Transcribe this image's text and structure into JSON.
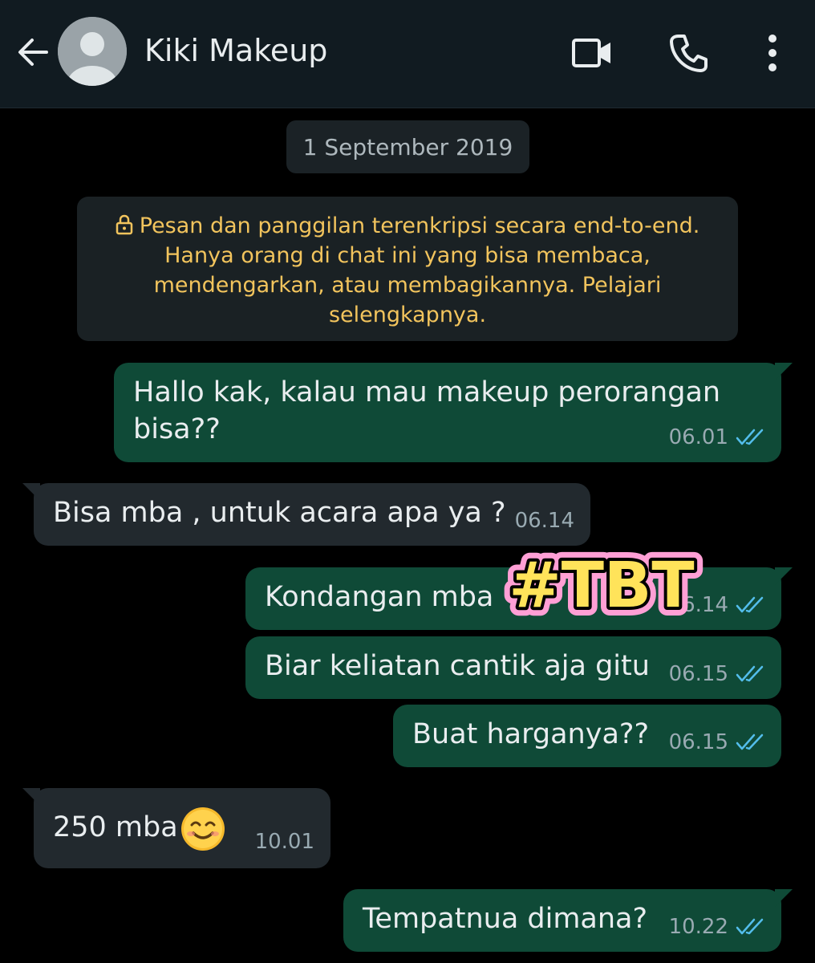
{
  "header": {
    "contact_name": "Kiki Makeup",
    "back_icon": "arrow-left-icon",
    "video_icon": "video-call-icon",
    "call_icon": "phone-icon",
    "more_icon": "more-vertical-icon"
  },
  "chat": {
    "date": "1 September 2019",
    "encryption_notice": "Pesan dan panggilan terenkripsi secara end-to-end. Hanya orang di chat ini yang bisa membaca, mendengarkan, atau membagikannya. Pelajari selengkapnya.",
    "messages": [
      {
        "direction": "out",
        "line1": "Hallo kak, kalau mau makeup perorangan",
        "line2": "bisa??",
        "time": "06.01"
      },
      {
        "direction": "in",
        "text": "Bisa mba , untuk acara apa ya ?",
        "time": "06.14"
      },
      {
        "direction": "out",
        "text": "Kondangan mba",
        "time": "06.14"
      },
      {
        "direction": "out",
        "text": "Biar keliatan cantik aja gitu",
        "time": "06.15"
      },
      {
        "direction": "out",
        "text": "Buat harganya??",
        "time": "06.15"
      },
      {
        "direction": "in",
        "text": "250 mba",
        "time": "10.01",
        "emoji": "smiling-face-icon"
      },
      {
        "direction": "out",
        "text": "Tempatnua dimana?",
        "time": "10.22"
      }
    ]
  },
  "sticker": {
    "text": "#TBT"
  },
  "colors": {
    "outgoing_bubble": "#0f4a37",
    "incoming_bubble": "#22292e",
    "read_ticks": "#53bdeb",
    "notice_text": "#f2c45d"
  }
}
